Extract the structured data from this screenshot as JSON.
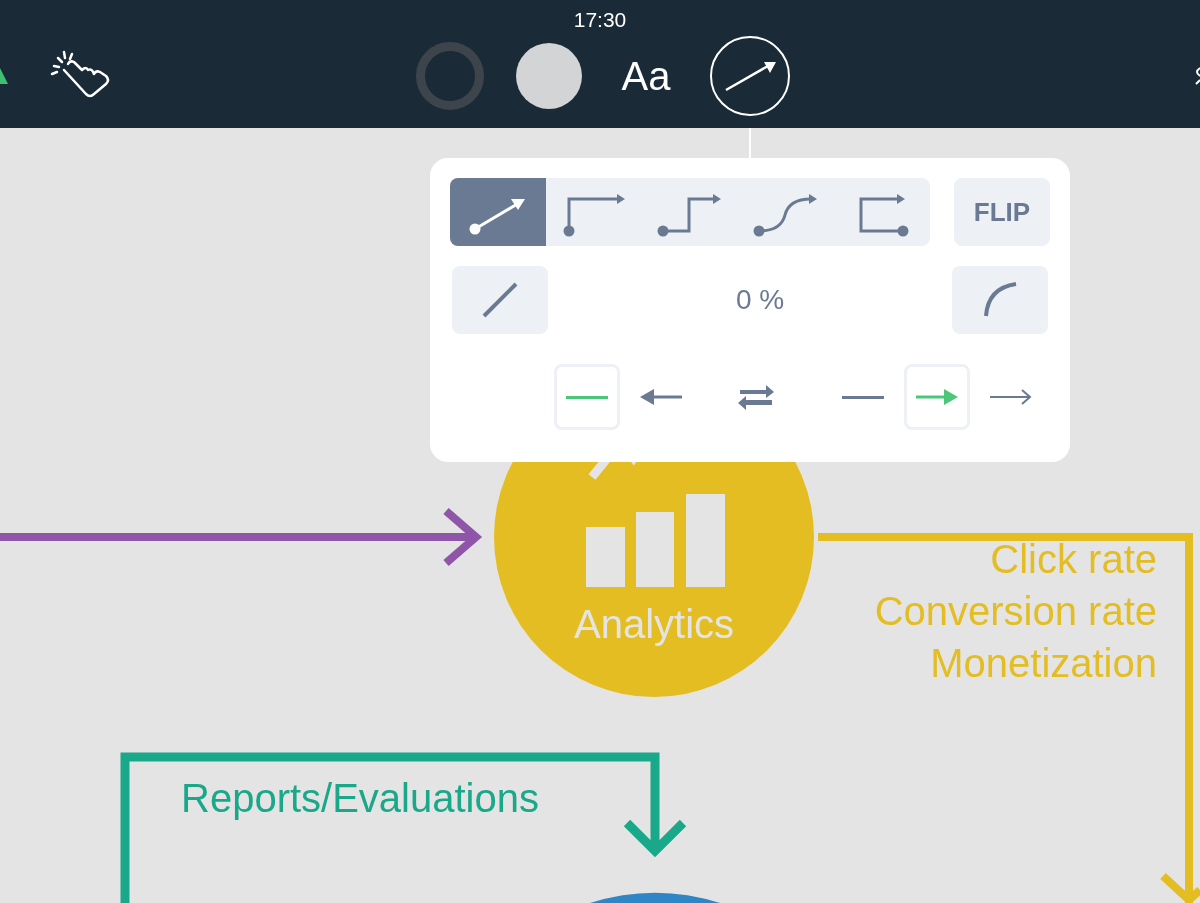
{
  "status_bar": {
    "time": "17:30"
  },
  "toolbar": {
    "items": [
      {
        "kind": "outline",
        "selected": false
      },
      {
        "kind": "fill",
        "selected": false
      },
      {
        "kind": "text",
        "label": "Aa",
        "selected": false
      },
      {
        "kind": "connector",
        "selected": true
      }
    ]
  },
  "connector_popover": {
    "line_styles": [
      {
        "kind": "straight",
        "selected": true
      },
      {
        "kind": "elbow",
        "selected": false
      },
      {
        "kind": "step",
        "selected": false
      },
      {
        "kind": "curve",
        "selected": false
      },
      {
        "kind": "bracket",
        "selected": false
      }
    ],
    "flip_button": "FLIP",
    "curvature_reading": "0 %",
    "start_caps": [
      {
        "kind": "none",
        "selected": true
      },
      {
        "kind": "arrow",
        "selected": false
      }
    ],
    "end_caps": [
      {
        "kind": "none",
        "selected": false
      },
      {
        "kind": "arrow",
        "selected": true
      },
      {
        "kind": "open-arrow",
        "selected": false
      }
    ]
  },
  "diagram": {
    "analytics_node": "Analytics",
    "analytics_edge_labels": [
      "Click rate",
      "Conversion rate",
      "Monetization"
    ],
    "reports_edge_label": "Reports/Evaluations"
  }
}
